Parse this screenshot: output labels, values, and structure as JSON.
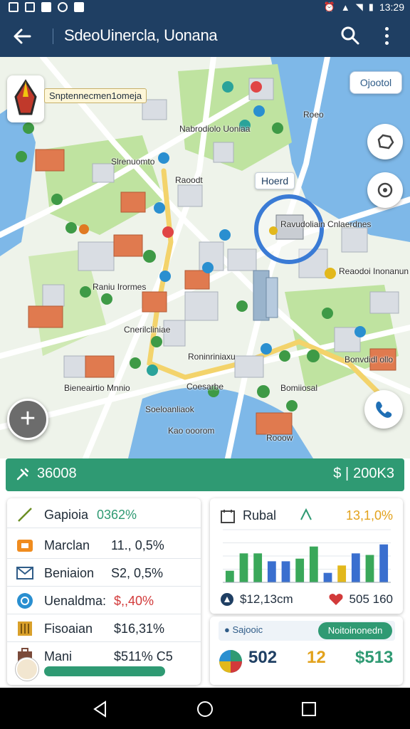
{
  "status_bar": {
    "time": "13:29",
    "icons": [
      "gallery-icon",
      "news-icon",
      "chart-icon",
      "sync-icon",
      "download-icon",
      "alarm-icon",
      "signal-icon",
      "wifi-icon",
      "battery-icon"
    ]
  },
  "app_bar": {
    "title": "SdeoUinercla, Uonana",
    "back_icon": "arrow-left-icon",
    "search_icon": "search-icon",
    "menu_icon": "more-vertical-icon"
  },
  "map": {
    "quick_chip": "Ojootol",
    "logo_label": "Snptennecmen1omeja",
    "selected_badge": "Hoerd",
    "labels": [
      "Roeo",
      "Nabrodiolo Uoniaa",
      "Slrenuomto",
      "Raoodt",
      "Ravudoliain Cnlaerdnes",
      "Reaodoi Inonanun",
      "Raniu Irormes",
      "Cnerilcliniae",
      "Roninriniaxu",
      "Bonvdidl ollo",
      "Bieneairtio Mnnio",
      "Soeloanliaok",
      "Kao ooorom",
      "Rooow",
      "Bomiiosal",
      "Coesarbe"
    ],
    "accent_colors": {
      "water": "#7eb8e8",
      "park": "#bfe3a0",
      "road": "#ffffff",
      "highlight_road": "#f3d36b",
      "selection_ring": "#3a7bd5"
    }
  },
  "summary_bar": {
    "left_value": "36008",
    "right_value": "200K3",
    "right_symbol": "$ |",
    "color": "#2f9a73"
  },
  "list_card": {
    "rows": [
      {
        "icon": "trend-icon",
        "name": "Gapioia",
        "value": "0362%",
        "value_color": "#2f9a73"
      },
      {
        "icon": "wallet-icon",
        "name": "Marclan",
        "value": "11., 0,5%",
        "value_color": "#1e2a36",
        "badge": "$"
      },
      {
        "icon": "mail-icon",
        "name": "Beniaion",
        "value": "S2, 0,5%",
        "value_color": "#1e2a36",
        "badge": "$"
      },
      {
        "icon": "circle-info-icon",
        "name": "Uenaldma:",
        "value": "$,,40%",
        "value_color": "#d23a3a"
      },
      {
        "icon": "building-icon",
        "name": "Fisoaian",
        "value": "$16,31%",
        "value_color": "#1e2a36"
      },
      {
        "icon": "suitcase-icon",
        "name": "Mani",
        "value": "$511% C5",
        "value_color": "#1e2a36"
      }
    ]
  },
  "chart_card": {
    "title": "Rubal",
    "percent": "13,1,0%",
    "stat_left": "$12,13cm",
    "stat_right": "505 160",
    "chart_data": {
      "type": "bar",
      "bars": [
        {
          "value": 0.22,
          "color": "#3aa85a"
        },
        {
          "value": 0.55,
          "color": "#3aa85a"
        },
        {
          "value": 0.55,
          "color": "#3aa85a"
        },
        {
          "value": 0.4,
          "color": "#3a6fcf"
        },
        {
          "value": 0.4,
          "color": "#3a6fcf"
        },
        {
          "value": 0.45,
          "color": "#3aa85a"
        },
        {
          "value": 0.68,
          "color": "#3aa85a"
        },
        {
          "value": 0.18,
          "color": "#3a6fcf"
        },
        {
          "value": 0.32,
          "color": "#e2b81c"
        },
        {
          "value": 0.55,
          "color": "#3a6fcf"
        },
        {
          "value": 0.52,
          "color": "#3aa85a"
        },
        {
          "value": 0.72,
          "color": "#3a6fcf"
        }
      ],
      "ylim": [
        0,
        1
      ],
      "grid": true
    }
  },
  "stats_card": {
    "label": "Sajooic",
    "button": "Noitoinonedn",
    "stats": [
      {
        "value": "502",
        "color": "#1f3f63"
      },
      {
        "value": "12",
        "color": "#e2a21c"
      },
      {
        "value": "$513",
        "color": "#2f9a73"
      }
    ]
  },
  "nav_bar": {
    "back_icon": "nav-back-icon",
    "home_icon": "nav-home-icon",
    "recents_icon": "nav-recents-icon"
  }
}
